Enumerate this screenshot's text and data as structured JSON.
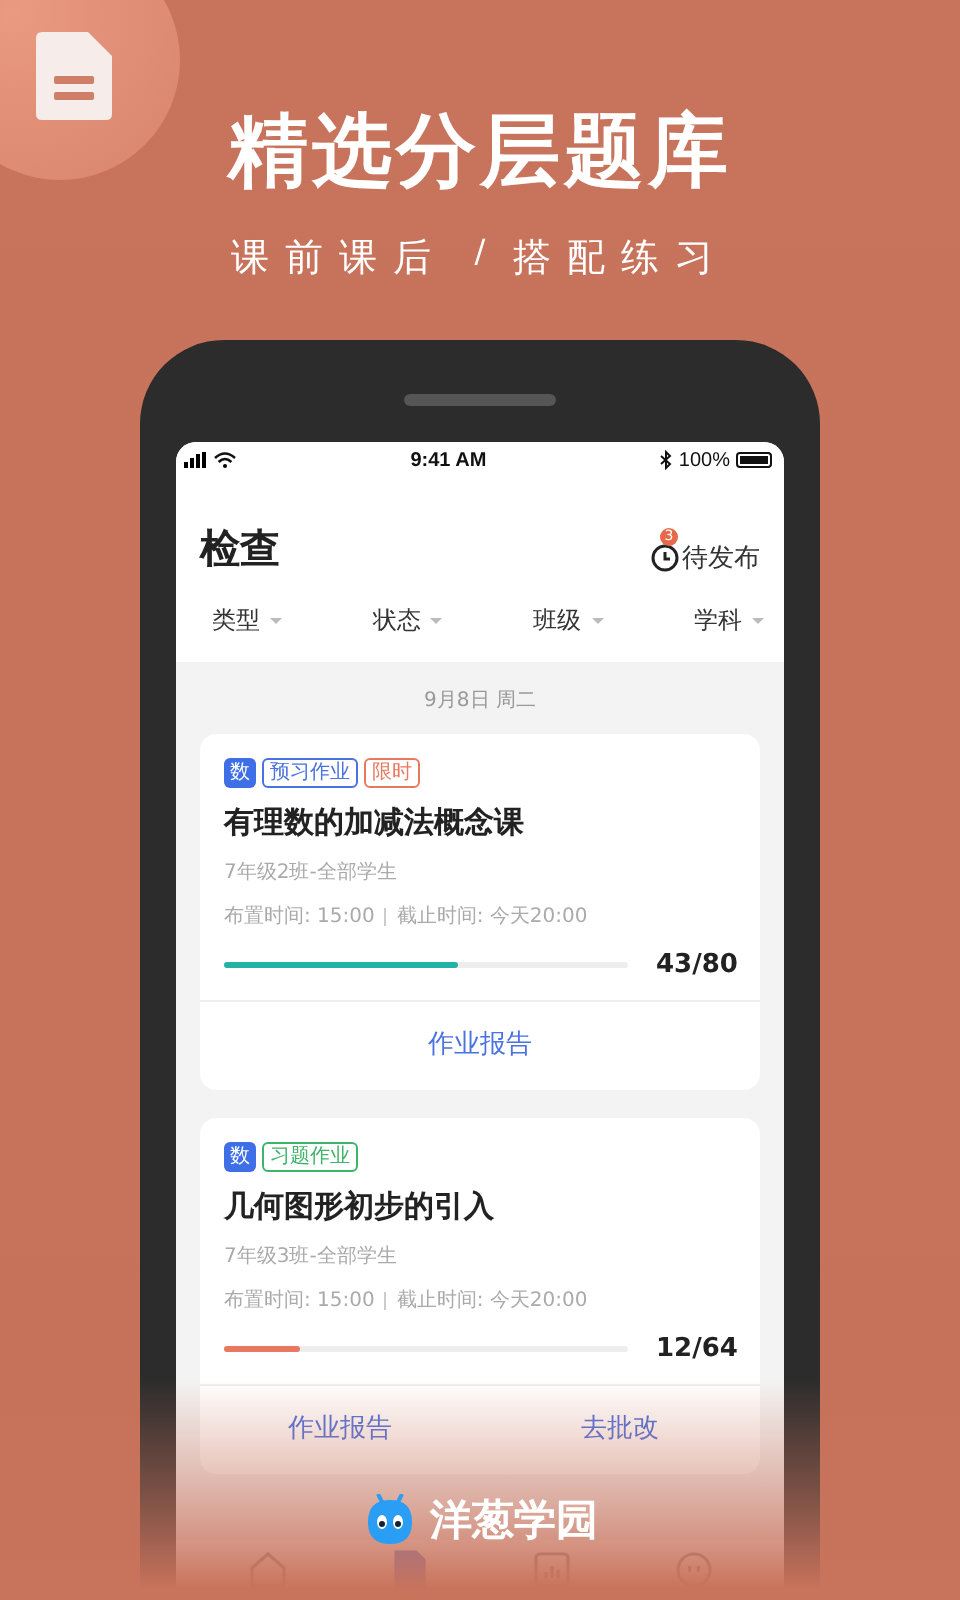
{
  "promo": {
    "title": "精选分层题库",
    "subtitle": [
      "课前课后",
      "/",
      "搭配练习"
    ],
    "brand": "洋葱学园"
  },
  "status_bar": {
    "time": "9:41 AM",
    "battery": "100%"
  },
  "header": {
    "title": "检查",
    "pending": {
      "label": "待发布",
      "badge": "3"
    }
  },
  "filters": [
    "类型",
    "状态",
    "班级",
    "学科"
  ],
  "date": "9月8日 周二",
  "assignments": [
    {
      "subject": "数",
      "tags": [
        {
          "text": "预习作业",
          "color": "#4a72e0"
        },
        {
          "text": "限时",
          "color": "#e8785f"
        }
      ],
      "title": "有理数的加减法概念课",
      "class": "7年级2班-全部学生",
      "assigned": "布置时间: 15:00",
      "deadline": "截止时间: 今天20:00",
      "level": 0.58,
      "count": "43/80",
      "color": "#22b3a6",
      "actions": [
        "作业报告"
      ]
    },
    {
      "subject": "数",
      "tags": [
        {
          "text": "习题作业",
          "color": "#3fb36a"
        }
      ],
      "title": "几何图形初步的引入",
      "class": "7年级3班-全部学生",
      "assigned": "布置时间: 15:00",
      "deadline": "截止时间: 今天20:00",
      "level": 0.19,
      "count": "12/64",
      "color": "#e8785f",
      "actions": [
        "作业报告",
        "去批改"
      ]
    }
  ],
  "tab_bar": [
    {
      "kind": "home",
      "selected": false
    },
    {
      "kind": "document",
      "selected": true
    },
    {
      "kind": "chart",
      "selected": false
    },
    {
      "kind": "profile",
      "selected": false
    }
  ]
}
